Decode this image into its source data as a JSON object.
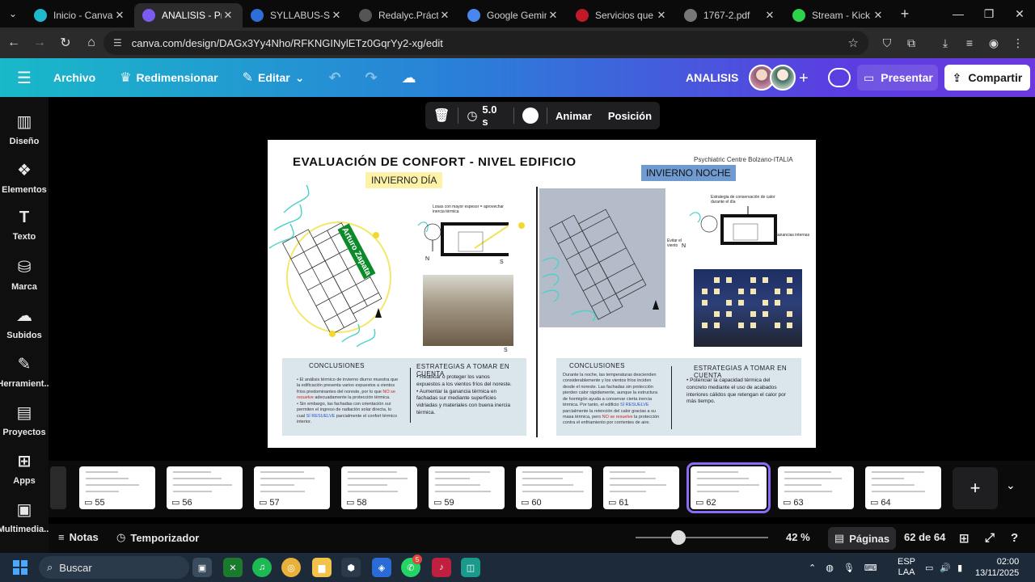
{
  "browser": {
    "tabs": [
      {
        "title": "Inicio - Canva",
        "favicon_color": "#1fb8cd",
        "active": false
      },
      {
        "title": "ANALISIS - Prese",
        "favicon_color": "#7b5cf0",
        "active": true
      },
      {
        "title": "SYLLABUS-SALU",
        "favicon_color": "#2f6dd8",
        "active": false
      },
      {
        "title": "Redalyc.Práctica",
        "favicon_color": "#555555",
        "active": false
      },
      {
        "title": "Google Gemini",
        "favicon_color": "#4a86f0",
        "active": false
      },
      {
        "title": "Servicios que br",
        "favicon_color": "#c01a2a",
        "active": false
      },
      {
        "title": "1767-2.pdf",
        "favicon_color": "#777777",
        "active": false
      },
      {
        "title": "Stream - Kick D",
        "favicon_color": "#2bd44a",
        "active": false
      }
    ],
    "url": "canva.com/design/DAGx3Yy4Nho/RFKNGINylETz0GqrYy2-xg/edit"
  },
  "canva_header": {
    "menu": [
      "Archivo",
      "Redimensionar",
      "Editar"
    ],
    "doc_name": "ANALISIS",
    "present_label": "Presentar",
    "share_label": "Compartir"
  },
  "sidebar": {
    "items": [
      {
        "label": "Diseño",
        "icon": "design-icon"
      },
      {
        "label": "Elementos",
        "icon": "elements-icon"
      },
      {
        "label": "Texto",
        "icon": "text-icon"
      },
      {
        "label": "Marca",
        "icon": "brand-icon"
      },
      {
        "label": "Subidos",
        "icon": "uploads-icon"
      },
      {
        "label": "Herramient...",
        "icon": "tools-icon"
      },
      {
        "label": "Proyectos",
        "icon": "projects-icon"
      },
      {
        "label": "Apps",
        "icon": "apps-icon"
      },
      {
        "label": "Multimedia...",
        "icon": "media-icon"
      }
    ]
  },
  "float_toolbar": {
    "duration": "5.0 s",
    "animate_label": "Animar",
    "position_label": "Posición"
  },
  "slide": {
    "title": "EVALUACIÓN DE CONFORT - NIVEL EDIFICIO",
    "subtitle": "Psychiatric Centre Bolzano-ITALIA",
    "tag_day": "INVIERNO DÍA",
    "tag_night": "INVIERNO NOCHE",
    "name_tag": "Arturo Zapata",
    "section_day_note": "Losas con mayor espesor = aprovechar inercia térmica",
    "section_night_note": "Estrategia de conservación de calor durante el día",
    "section_night_side": "Ganancias internas",
    "section_night_left": "Evitar el viento",
    "compass_n": "N",
    "compass_s": "S",
    "left_conclusions_title": "CONCLUSIONES",
    "left_conclusions_text_1": "El análisis térmico de invierno diurno muestra que la edificación presenta varios expuestos a vientos fríos predominantes del noreste, por lo que",
    "left_conclusions_no": "NO se resuelve",
    "left_conclusions_text_2": "adecuadamente la protección térmica.",
    "left_conclusions_text_3": "Sin embargo, las fachadas con orientación sur permiten el ingreso de radiación solar directa, lo cual",
    "left_conclusions_si": "SÍ RESUELVE",
    "left_conclusions_text_4": "parcialmente el confort térmico interior.",
    "left_strategies_title": "ESTRATEGIAS A TOMAR EN CUENTA",
    "left_strategy_1": "Reubicar o proteger los vanos expuestos a los vientos fríos del noreste.",
    "left_strategy_2": "Aumentar la ganancia térmica en fachadas sur mediante superficies vidriadas y materiales con buena inercia térmica.",
    "right_conclusions_title": "CONCLUSIONES",
    "right_conclusions_text_1": "Durante la noche, las temperaturas descienden considerablemente y los vientos fríos inciden desde el noreste.",
    "right_conclusions_text_2": "Las fachadas sin protección pierden calor rápidamente, aunque la estructura de hormigón ayuda a conservar cierta inercia térmica.",
    "right_conclusions_text_3": "Por tanto, el edificio",
    "right_conclusions_si": "SÍ RESUELVE",
    "right_conclusions_text_4": "parcialmente la retención del calor gracias a su masa térmica, pero",
    "right_conclusions_no": "NO se resuelve",
    "right_conclusions_text_5": "la protección contra el enfriamiento por corrientes de aire.",
    "right_strategies_title": "ESTRATEGIAS A TOMAR EN CUENTA",
    "right_strategy_1": "Potenciar la capacidad térmica del concreto mediante el uso de acabados interiores cálidos que retengan el calor por más tiempo."
  },
  "pages": {
    "thumbs": [
      "55",
      "56",
      "57",
      "58",
      "59",
      "60",
      "61",
      "62",
      "63",
      "64"
    ],
    "selected": "62"
  },
  "bottom_bar": {
    "notes_label": "Notas",
    "timer_label": "Temporizador",
    "zoom": "42 %",
    "zoom_level": 0.42,
    "pages_label": "Páginas",
    "page_count": "62 de 64"
  },
  "taskbar": {
    "search_label": "Buscar",
    "lang_line1": "ESP",
    "lang_line2": "LAA",
    "time": "02:00",
    "date": "13/11/2025",
    "whatsapp_badge": "5"
  },
  "colors": {
    "accent": "#8b6cf7",
    "header_gradient_start": "#19b9c9",
    "header_gradient_end": "#6a3ae0",
    "day_tag": "#fdf2a8",
    "night_tag": "#6f9bd1",
    "name_tag": "#0d8a2a"
  }
}
